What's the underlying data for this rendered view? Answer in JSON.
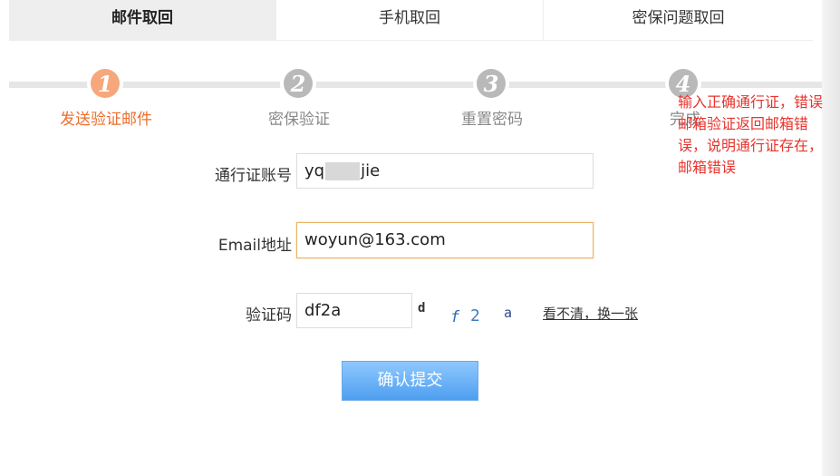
{
  "tabs": [
    {
      "label": "邮件取回",
      "active": true
    },
    {
      "label": "手机取回",
      "active": false
    },
    {
      "label": "密保问题取回",
      "active": false
    }
  ],
  "steps": [
    {
      "number": "1",
      "label": "发送验证邮件",
      "active": true
    },
    {
      "number": "2",
      "label": "密保验证",
      "active": false
    },
    {
      "number": "3",
      "label": "重置密码",
      "active": false
    },
    {
      "number": "4",
      "label": "完成",
      "active": false
    }
  ],
  "annotation": "输入正确通行证，错误邮箱验证返回邮箱错误，说明通行证存在，邮箱错误",
  "form": {
    "account_label": "通行证账号",
    "account_value_prefix": "yq",
    "account_value_suffix": "jie",
    "email_label": "Email地址",
    "email_value": "woyun@163.com",
    "captcha_label": "验证码",
    "captcha_value": "df2a",
    "captcha_chars": [
      "d",
      "f",
      "2",
      "a"
    ],
    "refresh_link": "看不清，换一张",
    "submit_label": "确认提交"
  },
  "colors": {
    "active_step": "#ec6f2d",
    "annotation": "#e8332c",
    "submit_button": "#4e9ff0"
  }
}
